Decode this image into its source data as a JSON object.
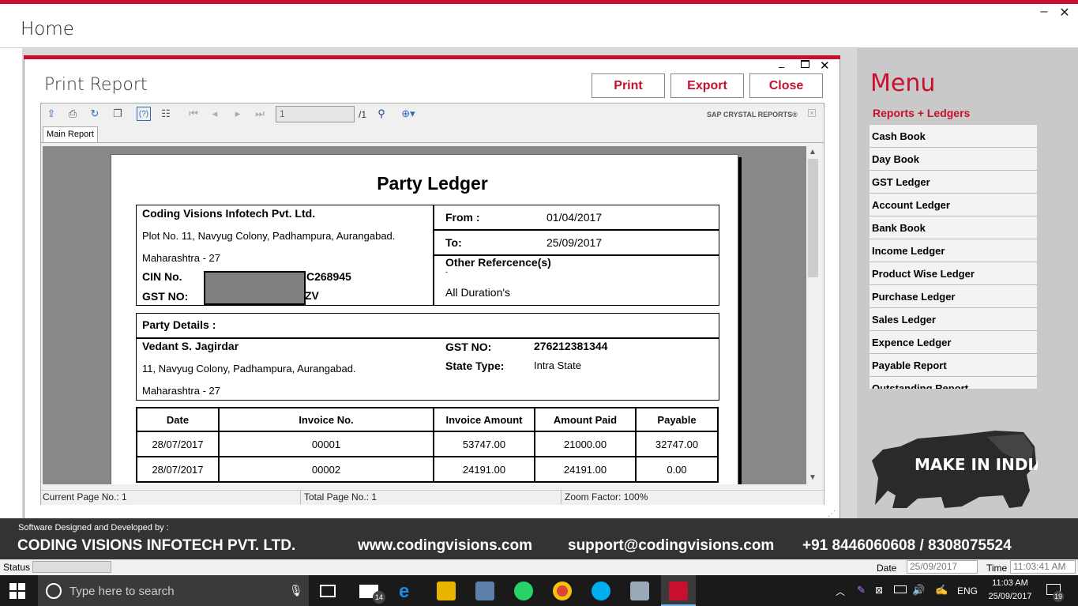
{
  "window": {
    "title": "Home",
    "minimize": "–",
    "close": "✕"
  },
  "dialog": {
    "title": "Print Report",
    "buttons": {
      "print": "Print",
      "export": "Export",
      "close": "Close"
    },
    "controls": {
      "minimize": "–",
      "close": "✕"
    }
  },
  "viewer": {
    "page_input": "1",
    "page_total": "/1",
    "brand": "SAP CRYSTAL REPORTS®",
    "tab": "Main Report",
    "status": {
      "current_page": "Current Page No.: 1",
      "total_page": "Total Page No.: 1",
      "zoom": "Zoom Factor: 100%"
    }
  },
  "report": {
    "title": "Party Ledger",
    "company": {
      "name": "Coding Visions Infotech Pvt. Ltd.",
      "address1": "Plot No. 11, Navyug Colony, Padhampura, Aurangabad.",
      "address2": "Maharashtra - 27",
      "cin_label": "CIN No.",
      "cin_value": "C268945",
      "gst_label": "GST NO:",
      "gst_value": "ZV"
    },
    "period": {
      "from_label": "From :",
      "from_value": "01/04/2017",
      "to_label": "To:",
      "to_value": "25/09/2017",
      "other_label": "Other Refercence(s)",
      "other_dash": "-",
      "other_value": "All Duration's"
    },
    "party": {
      "header": "Party Details :",
      "name": "Vedant S. Jagirdar",
      "address1": "11, Navyug Colony, Padhampura, Aurangabad.",
      "address2": "Maharashtra - 27",
      "gst_label": "GST NO:",
      "gst_value": "276212381344",
      "state_label": "State Type:",
      "state_value": "Intra State"
    },
    "table": {
      "headers": [
        "Date",
        "Invoice No.",
        "Invoice Amount",
        "Amount Paid",
        "Payable"
      ],
      "rows": [
        [
          "28/07/2017",
          "00001",
          "53747.00",
          "21000.00",
          "32747.00"
        ],
        [
          "28/07/2017",
          "00002",
          "24191.00",
          "24191.00",
          "0.00"
        ]
      ]
    }
  },
  "menu": {
    "title": "Menu",
    "header": "Reports + Ledgers",
    "items": [
      "Cash Book",
      "Day Book",
      "GST Ledger",
      "Account Ledger",
      "Bank Book",
      "Income Ledger",
      "Product Wise Ledger",
      "Purchase Ledger",
      "Sales Ledger",
      "Expence Ledger",
      "Payable Report",
      "Outstanding Report"
    ],
    "logo_text": "MAKE IN INDIA"
  },
  "footer": {
    "designed_by": "Software Designed and Developed by :",
    "company": "CODING VISIONS INFOTECH PVT. LTD.",
    "website": "www.codingvisions.com",
    "email": "support@codingvisions.com",
    "phone": "+91 8446060608 / 8308075524"
  },
  "statusbar": {
    "status_label": "Status",
    "date_label": "Date",
    "date_value": "25/09/2017",
    "time_label": "Time",
    "time_value": "11:03:41 AM"
  },
  "taskbar": {
    "search_placeholder": "Type here to search",
    "mail_badge": "14",
    "language": "ENG",
    "time": "11:03 AM",
    "date": "25/09/2017",
    "notifications": "19"
  },
  "colors": {
    "accent": "#c8102e",
    "footer": "#333333",
    "taskbar": "#1a1a1a"
  }
}
